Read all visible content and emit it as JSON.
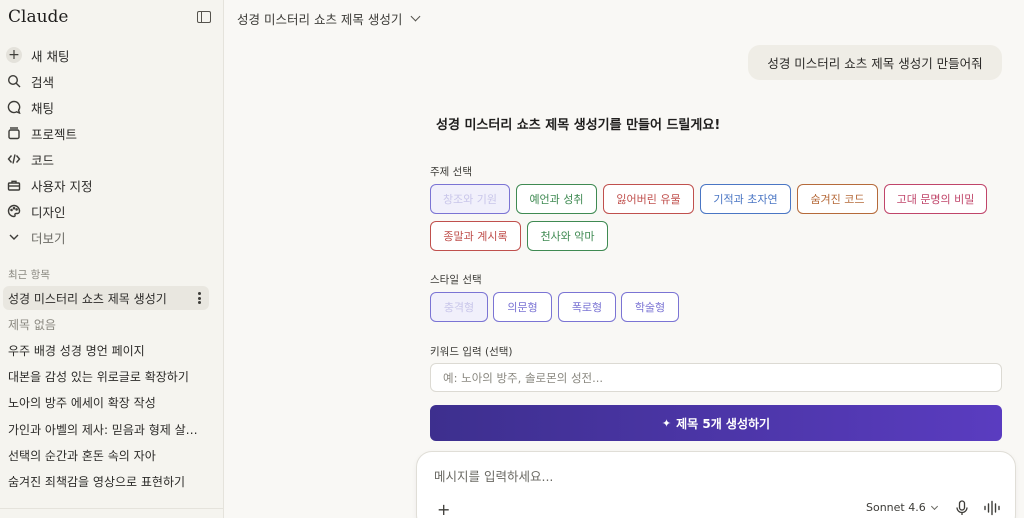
{
  "app": {
    "brand": "Claude"
  },
  "sidebar": {
    "nav": [
      {
        "label": "새 채팅",
        "icon": "plus-icon"
      },
      {
        "label": "검색",
        "icon": "search-icon"
      },
      {
        "label": "채팅",
        "icon": "chat-icon"
      },
      {
        "label": "프로젝트",
        "icon": "folder-icon"
      },
      {
        "label": "코드",
        "icon": "code-icon"
      },
      {
        "label": "사용자 지정",
        "icon": "toolbox-icon"
      },
      {
        "label": "디자인",
        "icon": "palette-icon"
      },
      {
        "label": "더보기",
        "icon": "chevron-down-icon"
      }
    ],
    "recent_label": "최근 항목",
    "recents": [
      "성경 미스터리 쇼츠 제목 생성기",
      "제목 없음",
      "우주 배경 성경 명언 페이지",
      "대본을 감성 있는 위로글로 확장하기",
      "노아의 방주 에세이 확장 작성",
      "가인과 아벨의 제사: 믿음과 형제 살…",
      "선택의 순간과 혼돈 속의 자아",
      "숨겨진 죄책감을 영상으로 표현하기"
    ]
  },
  "header": {
    "title": "성경 미스터리 쇼츠 제목 생성기"
  },
  "conversation": {
    "user_message": "성경 미스터리 쇼츠 제목 생성기 만들어줘",
    "assistant_heading": "성경 미스터리 쇼츠 제목 생성기를 만들어 드릴게요!"
  },
  "generator": {
    "topic_label": "주제 선택",
    "topics": [
      "창조와 기원",
      "예언과 성취",
      "잃어버린 유물",
      "기적과 초자연",
      "숨겨진 코드",
      "고대 문명의 비밀",
      "종말과 계시록",
      "천사와 악마"
    ],
    "topic_colors": [
      "#7b74d4",
      "#3f8a52",
      "#c0504d",
      "#4a76c4",
      "#b56a3a",
      "#c0456a",
      "#c0504d",
      "#3f8a52"
    ],
    "style_label": "스타일 선택",
    "styles": [
      "충격형",
      "의문형",
      "폭로형",
      "학술형"
    ],
    "style_color": "#7b74d4",
    "keyword_label": "키워드 입력 (선택)",
    "keyword_placeholder": "예: 노아의 방주, 솔로몬의 성전...",
    "generate_label": "제목 5개 생성하기"
  },
  "composer": {
    "placeholder": "메시지를 입력하세요...",
    "model": "Sonnet 4.6"
  }
}
